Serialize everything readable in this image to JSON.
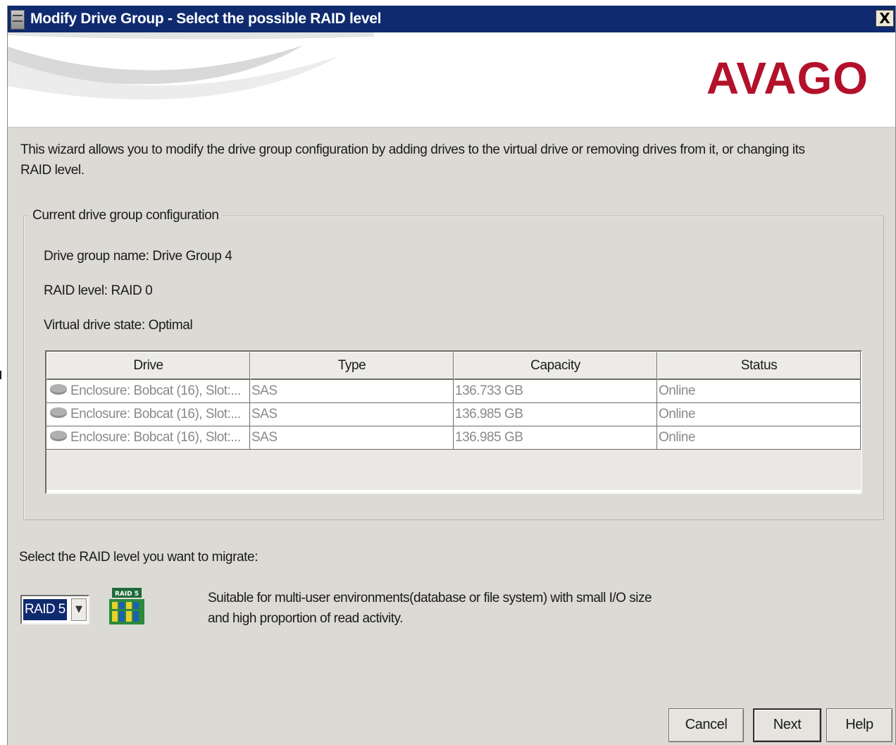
{
  "window": {
    "title": "Modify Drive Group - Select the possible RAID level",
    "close_label": "X"
  },
  "banner": {
    "brand": "AVAGO",
    "brand_color": "#b3112b"
  },
  "intro": "This wizard allows you to modify the drive group configuration by adding drives to the virtual drive or removing drives from it, or changing its RAID level.",
  "current_config": {
    "legend": "Current drive group configuration",
    "group_name": "Drive group name: Drive Group 4",
    "raid_level": "RAID level: RAID 0",
    "state": "Virtual drive state: Optimal"
  },
  "table": {
    "columns": [
      "Drive",
      "Type",
      "Capacity",
      "Status"
    ],
    "rows": [
      {
        "drive": "Enclosure: Bobcat (16), Slot:...",
        "type": "SAS",
        "capacity": "136.733 GB",
        "status": "Online"
      },
      {
        "drive": "Enclosure: Bobcat (16), Slot:...",
        "type": "SAS",
        "capacity": "136.985 GB",
        "status": "Online"
      },
      {
        "drive": "Enclosure: Bobcat (16), Slot:...",
        "type": "SAS",
        "capacity": "136.985 GB",
        "status": "Online"
      }
    ]
  },
  "migrate": {
    "label": "Select the RAID level you want to migrate:",
    "selected": "RAID 5",
    "icon_caption": "RAID 5",
    "description": "Suitable for multi-user environments(database or file system) with small I/O size and high proportion of read activity."
  },
  "buttons": {
    "cancel": "Cancel",
    "next": "Next",
    "help": "Help"
  },
  "colors": {
    "title_bar": "#0f2a6e",
    "dialog_bg": "#dcdad5",
    "disabled_text": "#8a8a88"
  }
}
